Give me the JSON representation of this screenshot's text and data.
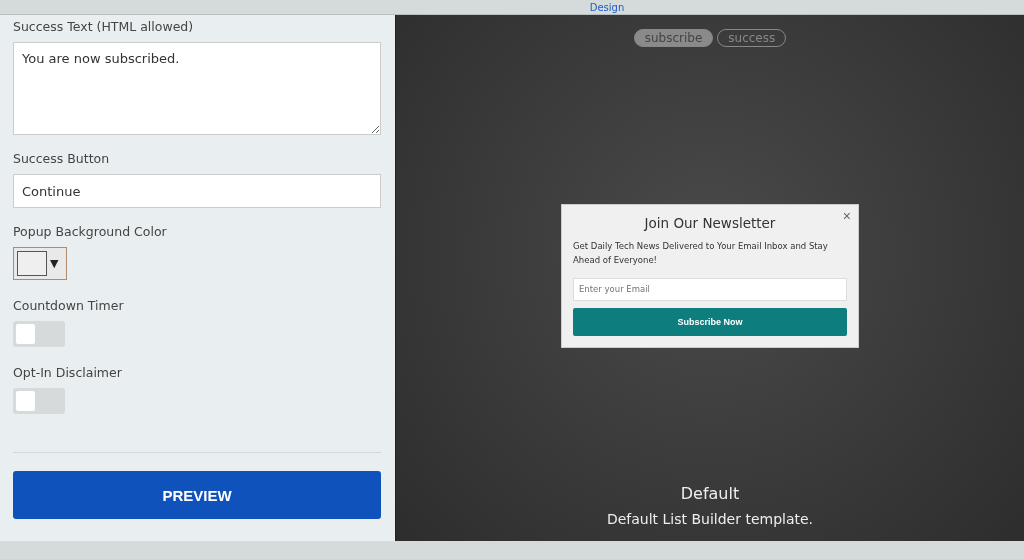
{
  "top_bar": {
    "link": "Design"
  },
  "settings": {
    "success_text": {
      "label": "Success Text (HTML allowed)",
      "value": "You are now subscribed."
    },
    "success_button": {
      "label": "Success Button",
      "value": "Continue"
    },
    "popup_background_color": {
      "label": "Popup Background Color",
      "arrow": "▼"
    },
    "toggles": [
      {
        "label": "Countdown Timer",
        "on": false
      },
      {
        "label": "Opt-In Disclaimer",
        "on": false
      }
    ],
    "preview_button": "PREVIEW"
  },
  "preview": {
    "tabs": [
      {
        "label": "subscribe",
        "selected": true
      },
      {
        "label": "success",
        "selected": false
      }
    ],
    "popup": {
      "title": "Join Our Newsletter",
      "close": "×",
      "text": "Get Daily Tech News Delivered to Your Email Inbox and Stay Ahead of Everyone!",
      "email_placeholder": "Enter your Email",
      "button": "Subscribe Now"
    },
    "template_name": "Default",
    "template_description": "Default List Builder template."
  }
}
